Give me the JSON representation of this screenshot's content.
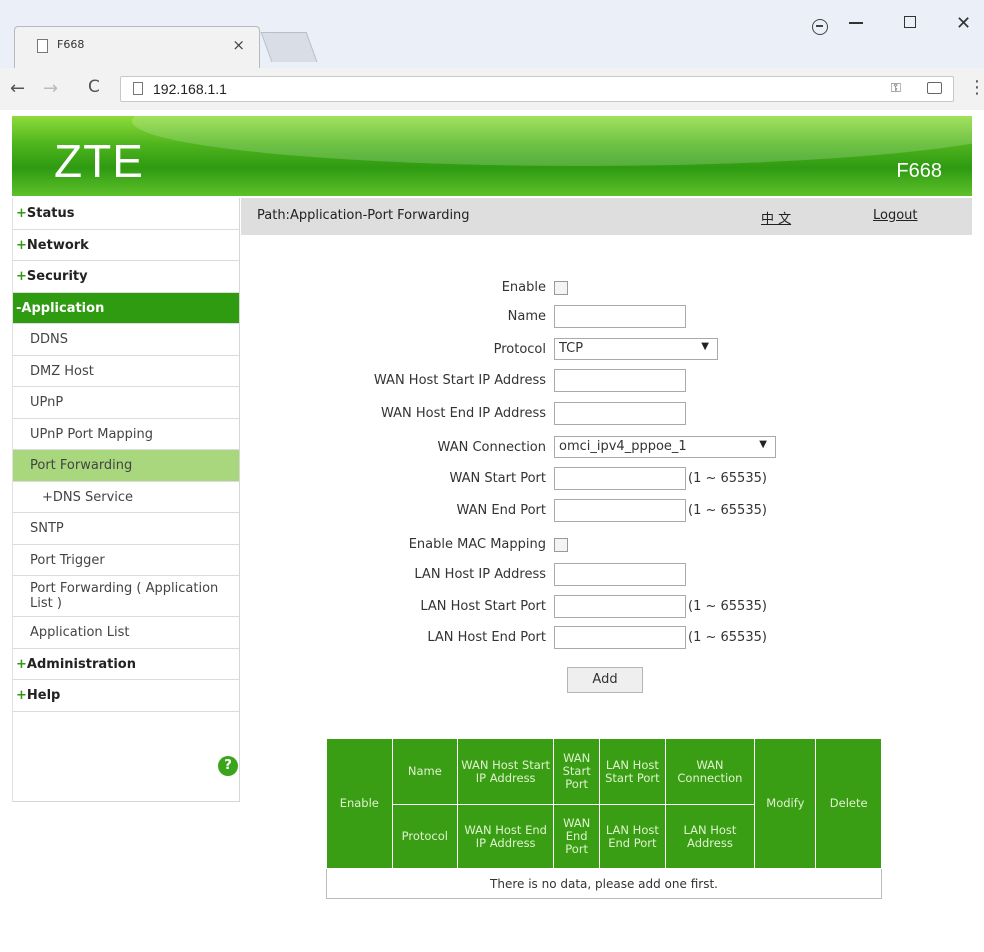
{
  "browser": {
    "tab_title": "F668",
    "tab_close": "×",
    "url": "192.168.1.1"
  },
  "banner": {
    "logo": "ZTE",
    "model": "F668"
  },
  "sidebar": {
    "items": [
      {
        "sign": "+",
        "label": "Status"
      },
      {
        "sign": "+",
        "label": "Network"
      },
      {
        "sign": "+",
        "label": "Security"
      },
      {
        "sign": "-",
        "label": "Application"
      },
      {
        "label": "DDNS"
      },
      {
        "label": "DMZ Host"
      },
      {
        "label": "UPnP"
      },
      {
        "label": "UPnP Port Mapping"
      },
      {
        "label": "Port Forwarding"
      },
      {
        "label": "+DNS Service"
      },
      {
        "label": "SNTP"
      },
      {
        "label": "Port Trigger"
      },
      {
        "label": "Port Forwarding ( Application List )"
      },
      {
        "label": "Application List"
      },
      {
        "sign": "+",
        "label": "Administration"
      },
      {
        "sign": "+",
        "label": "Help"
      }
    ],
    "help_icon": "?"
  },
  "pathbar": {
    "path": "Path:Application-Port Forwarding",
    "lang": "中 文",
    "logout": "Logout"
  },
  "form": {
    "enable_label": "Enable",
    "name_label": "Name",
    "name_value": "",
    "protocol_label": "Protocol",
    "protocol_value": "TCP",
    "wan_host_start_ip_label": "WAN Host Start IP Address",
    "wan_host_end_ip_label": "WAN Host End IP Address",
    "wan_connection_label": "WAN Connection",
    "wan_connection_value": "omci_ipv4_pppoe_1",
    "wan_start_port_label": "WAN Start Port",
    "wan_end_port_label": "WAN End Port",
    "enable_mac_mapping_label": "Enable MAC Mapping",
    "lan_host_ip_label": "LAN Host IP Address",
    "lan_host_start_port_label": "LAN Host Start Port",
    "lan_host_end_port_label": "LAN Host End Port",
    "port_range_hint": "(1 ~ 65535)",
    "add_button": "Add"
  },
  "table": {
    "header_row1": [
      "Enable",
      "Name",
      "WAN Host Start IP Address",
      "WAN Start Port",
      "LAN Host Start Port",
      "WAN Connection",
      "Modify",
      "Delete"
    ],
    "header_row2": [
      "Protocol",
      "WAN Host End IP Address",
      "WAN End Port",
      "LAN Host End Port",
      "LAN Host Address"
    ],
    "empty_message": "There is no data, please add one first."
  },
  "colors": {
    "brand_green": "#2f9b11",
    "selected_item": "#a8d77e"
  }
}
